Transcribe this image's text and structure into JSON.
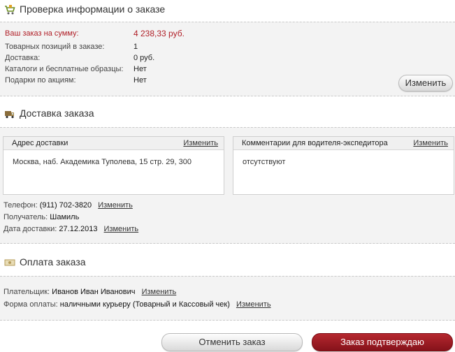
{
  "order_check": {
    "title": "Проверка информации о заказе",
    "total_label": "Ваш заказ на сумму:",
    "total_value": "4 238,33 руб.",
    "items_label": "Товарных позиций в заказе:",
    "items_value": "1",
    "delivery_label": "Доставка:",
    "delivery_value": "0 руб.",
    "catalogs_label": "Каталоги и бесплатные образцы:",
    "catalogs_value": "Нет",
    "gifts_label": "Подарки по акциям:",
    "gifts_value": "Нет",
    "change_button": "Изменить",
    "accent_color": "#b01f27"
  },
  "delivery": {
    "title": "Доставка заказа",
    "address_box": {
      "title": "Адрес доставки",
      "change_link": "Изменить",
      "value": "Москва, наб. Академика Туполева, 15 стр. 29, 300"
    },
    "comment_box": {
      "title": "Комментарии для водителя-экспедитора",
      "change_link": "Изменить",
      "value": "отсутствуют"
    },
    "phone_label": "Телефон:",
    "phone_value": "(911) 702-3820",
    "phone_change": "Изменить",
    "recipient_label": "Получатель:",
    "recipient_value": "Шамиль",
    "date_label": "Дата доставки:",
    "date_value": "27.12.2013",
    "date_change": "Изменить"
  },
  "payment": {
    "title": "Оплата заказа",
    "payer_label": "Плательщик:",
    "payer_value": "Иванов Иван Иванович",
    "payer_change": "Изменить",
    "method_label": "Форма оплаты:",
    "method_value": "наличными курьеру (Товарный и Кассовый чек)",
    "method_change": "Изменить"
  },
  "actions": {
    "cancel_button": "Отменить заказ",
    "confirm_button": "Заказ подтверждаю"
  },
  "icons": {
    "order": "cart-icon",
    "delivery": "truck-icon",
    "payment": "banknote-icon"
  }
}
